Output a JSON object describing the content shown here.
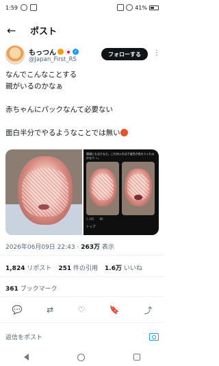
{
  "status_bar": {
    "time": "1:59",
    "battery": "41%"
  },
  "header": {
    "title": "ポスト"
  },
  "author": {
    "name": "もっつん",
    "handle": "@Japan_First_RS",
    "follow_label": "フォローする"
  },
  "tweet": {
    "lines": [
      "なんでこんなことする",
      "親がいるのかなぁ",
      "",
      "赤ちゃんにパックなんて必要ない",
      "",
      "面白半分でやるようなことでは無い"
    ]
  },
  "embedded": {
    "text": "寝顔にも当りなど。これ何入れば子度色が良れてくれるかなウ ☆。",
    "likes": "1,165",
    "retweets": "80",
    "foot": "トップ"
  },
  "meta": {
    "datetime": "2026年06月09日 22:43",
    "views": "263万",
    "views_label": "表示"
  },
  "stats": {
    "reposts": "1,824",
    "reposts_label": "リポスト",
    "quotes": "251",
    "quotes_label": "件の引用",
    "likes": "1.6万",
    "likes_label": "いいね",
    "bookmarks": "361",
    "bookmarks_label": "ブックマーク"
  },
  "reply": {
    "placeholder": "返信をポスト"
  },
  "colors": {
    "accent": "#1d9bf0",
    "text": "#0f1419",
    "muted": "#536471"
  }
}
